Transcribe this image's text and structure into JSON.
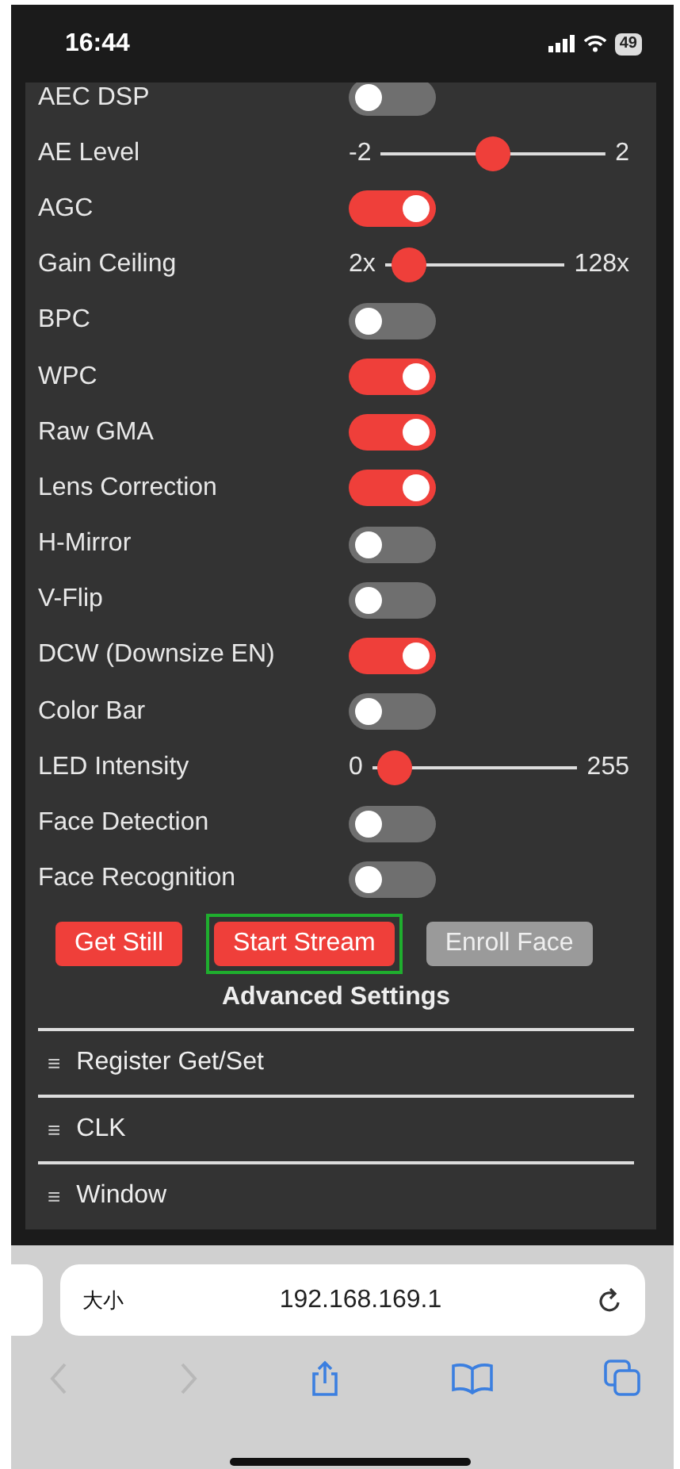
{
  "status_bar": {
    "time": "16:44",
    "battery": "49"
  },
  "settings": [
    {
      "kind": "toggle",
      "label": "AEC DSP",
      "on": false
    },
    {
      "kind": "slider",
      "label": "AE Level",
      "min": "-2",
      "max": "2",
      "level": 0.5
    },
    {
      "kind": "toggle",
      "label": "AGC",
      "on": true
    },
    {
      "kind": "slider",
      "label": "Gain Ceiling",
      "min": "2x",
      "max": "128x",
      "level": 0.05
    },
    {
      "kind": "toggle",
      "label": "BPC",
      "on": false
    },
    {
      "kind": "toggle",
      "label": "WPC",
      "on": true
    },
    {
      "kind": "toggle",
      "label": "Raw GMA",
      "on": true
    },
    {
      "kind": "toggle",
      "label": "Lens Correction",
      "on": true
    },
    {
      "kind": "toggle",
      "label": "H-Mirror",
      "on": false
    },
    {
      "kind": "toggle",
      "label": "V-Flip",
      "on": false
    },
    {
      "kind": "toggle",
      "label": "DCW (Downsize EN)",
      "on": true
    },
    {
      "kind": "toggle",
      "label": "Color Bar",
      "on": false
    },
    {
      "kind": "slider",
      "label": "LED Intensity",
      "min": "0",
      "max": "255",
      "level": 0.03
    },
    {
      "kind": "toggle",
      "label": "Face Detection",
      "on": false
    },
    {
      "kind": "toggle",
      "label": "Face Recognition",
      "on": false
    }
  ],
  "buttons": [
    {
      "label": "Get Still",
      "disabled": false,
      "outlined": false
    },
    {
      "label": "Start Stream",
      "disabled": false,
      "outlined": true
    },
    {
      "label": "Enroll Face",
      "disabled": true,
      "outlined": false
    }
  ],
  "advanced": {
    "title": "Advanced Settings",
    "sections": [
      "Register Get/Set",
      "CLK",
      "Window"
    ],
    "menu_glyph": "≡"
  },
  "browser": {
    "text_size": "大小",
    "address": "192.168.169.1"
  }
}
